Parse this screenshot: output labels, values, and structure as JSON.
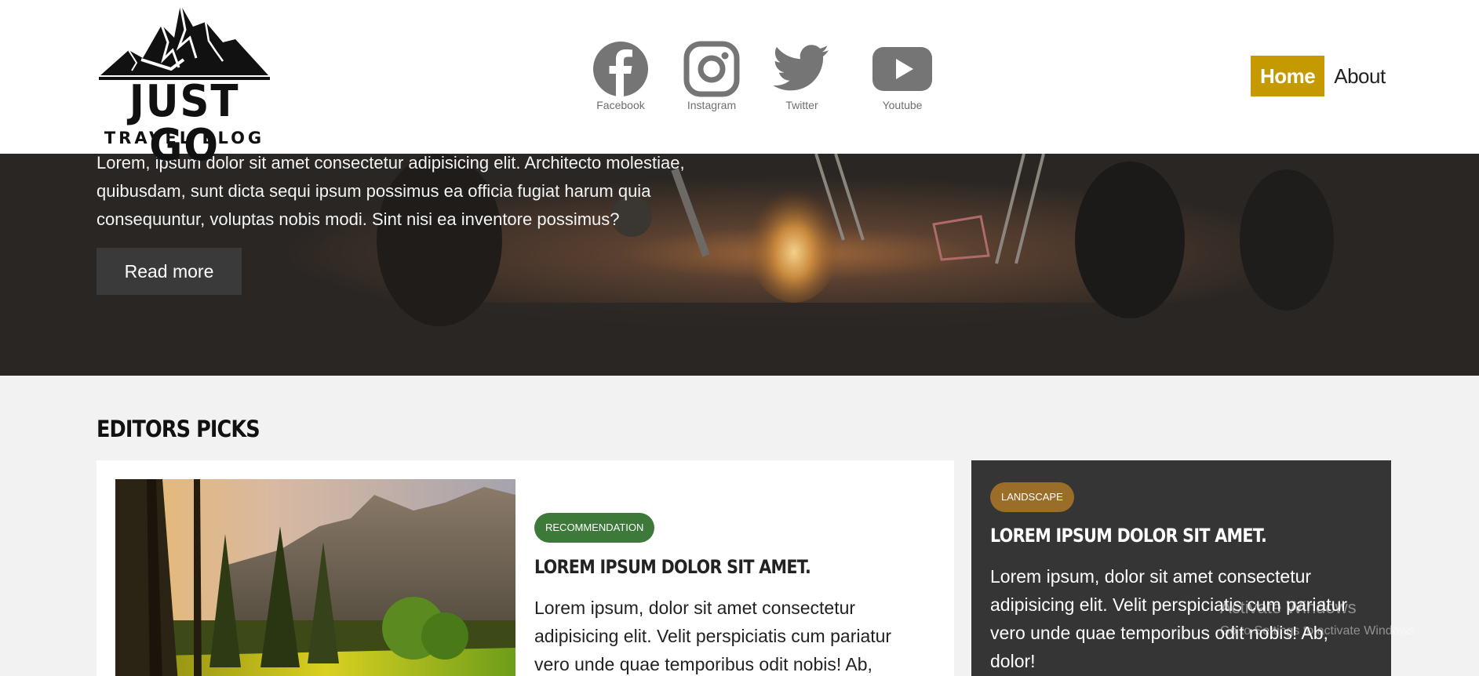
{
  "header": {
    "logo": {
      "main": "JUST GO",
      "sub": "TRAVEL BLOG"
    },
    "social": [
      {
        "label": "Facebook",
        "icon": "facebook-icon"
      },
      {
        "label": "Instagram",
        "icon": "instagram-icon"
      },
      {
        "label": "Twitter",
        "icon": "twitter-icon"
      },
      {
        "label": "Youtube",
        "icon": "youtube-icon"
      }
    ],
    "nav": {
      "home": "Home",
      "about": "About"
    }
  },
  "hero": {
    "text": "Lorem, ipsum dolor sit amet consectetur adipisicing elit. Architecto molestiae, quibusdam, sunt dicta sequi ipsum possimus ea officia fugiat harum quia consequuntur, voluptas nobis modi. Sint nisi ea inventore possimus?",
    "button": "Read more"
  },
  "editors_picks": {
    "title": "EDITORS PICKS",
    "main_card": {
      "tag": "RECOMMENDATION",
      "title": "LOREM IPSUM DOLOR SIT AMET.",
      "text": "Lorem ipsum, dolor sit amet consectetur adipisicing elit. Velit perspiciatis cum pariatur vero unde quae temporibus odit nobis! Ab,"
    },
    "side_card": {
      "tag": "LANDSCAPE",
      "title": "LOREM IPSUM DOLOR SIT AMET.",
      "text": "Lorem ipsum, dolor sit amet consectetur adipisicing elit. Velit perspiciatis cum pariatur vero unde quae temporibus odit nobis! Ab, dolor!"
    }
  },
  "watermark": {
    "line1": "Activate Windows",
    "line2": "Go to Settings to activate Windows."
  },
  "colors": {
    "accent": "#c49a00",
    "tag_green": "#3d7a3a",
    "tag_brown": "#9a6d28",
    "dark_card": "#353535",
    "icon_gray": "#757575"
  }
}
